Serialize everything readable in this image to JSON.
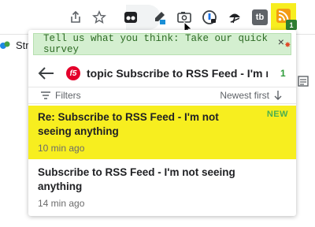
{
  "toolbar": {
    "icons": [
      "share-icon",
      "star-icon",
      "tab-ext-icon",
      "eyedropper-icon",
      "screenshot-icon",
      "password-icon",
      "umbrella-icon",
      "tb-icon",
      "rss-icon"
    ],
    "tb_label": "tb",
    "rss_badge": "1",
    "accent_highlight": "#f7ee1f"
  },
  "bookmarks": {
    "item_label": "Stra"
  },
  "popup": {
    "survey": {
      "text": "Tell us what you think: Take our quick survey",
      "close": "×"
    },
    "header": {
      "logo_text": "f5",
      "title": "topic Subscribe to RSS Feed - I'm n...",
      "count": "1"
    },
    "filter_label": "Filters",
    "sort_label": "Newest first",
    "items": [
      {
        "title": "Re: Subscribe to RSS Feed - I'm not seeing anything",
        "time": "10 min ago",
        "badge": "NEW"
      },
      {
        "title": "Subscribe to RSS Feed - I'm not seeing anything",
        "time": "14 min ago",
        "badge": ""
      }
    ]
  },
  "colors": {
    "survey_bg": "#d4efd0",
    "survey_text": "#2e6b25",
    "new_badge": "#4caf50",
    "count": "#2e9b3a",
    "f5_red": "#e4002b"
  }
}
